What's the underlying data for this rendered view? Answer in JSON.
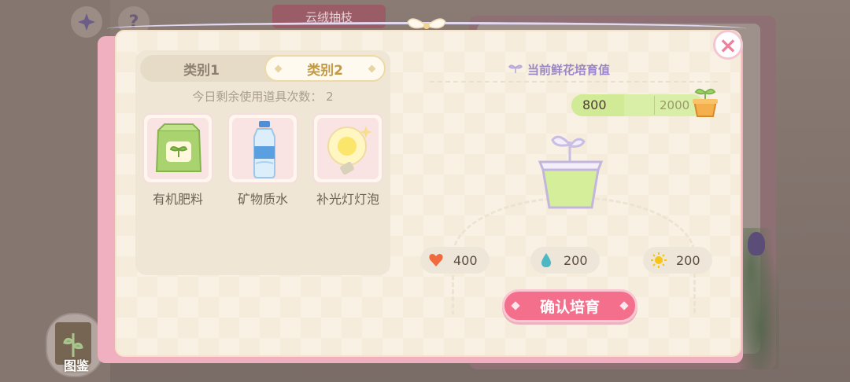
{
  "background": {
    "banner_text": "云绒抽枝",
    "help_label": "?",
    "atlas_label": "图鉴"
  },
  "panel": {
    "close_label": "×",
    "tabs": [
      {
        "label": "类别1",
        "selected": false
      },
      {
        "label": "类别2",
        "selected": true
      }
    ],
    "remaining_text": "今日剩余使用道具次数：  2",
    "items": [
      {
        "name": "有机肥料",
        "icon": "fertilizer-bag-icon"
      },
      {
        "name": "矿物质水",
        "icon": "water-bottle-icon"
      },
      {
        "name": "补光灯灯泡",
        "icon": "light-bulb-icon"
      }
    ],
    "nurture_title": "当前鲜花培育值",
    "nurture_value": "800",
    "nurture_max": "2000",
    "nurture_progress": 0.4,
    "stats": [
      {
        "icon": "heart-icon",
        "value": "400",
        "color": "#f0693f"
      },
      {
        "icon": "water-drop-icon",
        "value": "200",
        "color": "#4db8c4"
      },
      {
        "icon": "sun-icon",
        "value": "200",
        "color": "#f5c518"
      }
    ],
    "confirm_label": "确认培育"
  },
  "colors": {
    "accent_pink": "#f36f8c",
    "progress_green": "#d0ea96",
    "title_purple": "#9b87c6"
  }
}
